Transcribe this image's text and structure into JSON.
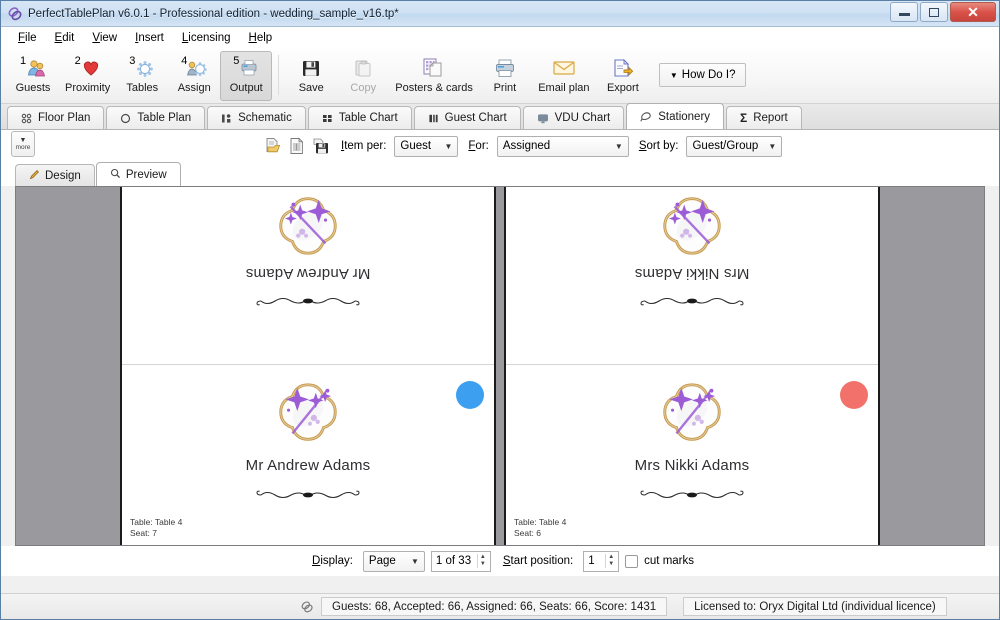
{
  "window": {
    "title": "PerfectTablePlan v6.0.1 - Professional edition - wedding_sample_v16.tp*",
    "app_icon": "app-logo-icon",
    "minimize_label": "Minimize",
    "maximize_label": "Maximize",
    "close_label": "Close"
  },
  "menu": {
    "items": [
      {
        "label": "File",
        "accel": "F"
      },
      {
        "label": "Edit",
        "accel": "E"
      },
      {
        "label": "View",
        "accel": "V"
      },
      {
        "label": "Insert",
        "accel": "I"
      },
      {
        "label": "Licensing",
        "accel": "L"
      },
      {
        "label": "Help",
        "accel": "H"
      }
    ]
  },
  "toolbar": {
    "buttons": [
      {
        "num": "1",
        "label": "Guests",
        "icon": "guests-icon",
        "state": "normal"
      },
      {
        "num": "2",
        "label": "Proximity",
        "icon": "heart-icon",
        "state": "normal"
      },
      {
        "num": "3",
        "label": "Tables",
        "icon": "table-icon",
        "state": "normal"
      },
      {
        "num": "4",
        "label": "Assign",
        "icon": "assign-icon",
        "state": "normal"
      },
      {
        "num": "5",
        "label": "Output",
        "icon": "output-icon",
        "state": "active"
      }
    ],
    "buttons2": [
      {
        "label": "Save",
        "icon": "floppy-icon",
        "state": "normal"
      },
      {
        "label": "Copy",
        "icon": "clipboard-icon",
        "state": "disabled"
      },
      {
        "label": "Posters & cards",
        "icon": "posters-icon",
        "state": "normal"
      },
      {
        "label": "Print",
        "icon": "printer-icon",
        "state": "normal"
      },
      {
        "label": "Email plan",
        "icon": "envelope-icon",
        "state": "normal"
      },
      {
        "label": "Export",
        "icon": "export-icon",
        "state": "normal"
      }
    ],
    "how_do_i": "How Do I?"
  },
  "tabs": {
    "items": [
      {
        "label": "Floor Plan",
        "icon": "floorplan-icon",
        "selected": false
      },
      {
        "label": "Table Plan",
        "icon": "circle-table-icon",
        "selected": false
      },
      {
        "label": "Schematic",
        "icon": "schematic-icon",
        "selected": false
      },
      {
        "label": "Table Chart",
        "icon": "table-chart-icon",
        "selected": false
      },
      {
        "label": "Guest Chart",
        "icon": "guest-chart-icon",
        "selected": false
      },
      {
        "label": "VDU Chart",
        "icon": "vdu-icon",
        "selected": false
      },
      {
        "label": "Stationery",
        "icon": "stationery-icon",
        "selected": true
      },
      {
        "label": "Report",
        "icon": "sigma-icon",
        "selected": false
      }
    ]
  },
  "subbar": {
    "more_label": "more",
    "more_caret": "▼",
    "icons": [
      {
        "name": "open-template-icon",
        "title": "Open template"
      },
      {
        "name": "new-template-icon",
        "title": "New template"
      },
      {
        "name": "save-template-icon",
        "title": "Save template"
      }
    ],
    "item_per_label": "Item per:",
    "item_per_accel": "I",
    "item_per_value": "Guest",
    "for_label": "For:",
    "for_accel": "F",
    "for_value": "Assigned",
    "sort_by_label": "Sort by:",
    "sort_by_accel": "S",
    "sort_by_value": "Guest/Group"
  },
  "inner_tabs": {
    "items": [
      {
        "label": "Design",
        "icon": "pencil-icon",
        "selected": false
      },
      {
        "label": "Preview",
        "icon": "magnifier-icon",
        "selected": true
      }
    ]
  },
  "preview": {
    "cards": [
      {
        "name": "Mr Andrew Adams",
        "table_line": "Table: Table 4",
        "seat_line": "Seat: 7",
        "dot_color": "#3d9ff0",
        "dot_class": "blue"
      },
      {
        "name": "Mrs Nikki Adams",
        "table_line": "Table: Table 4",
        "seat_line": "Seat: 6",
        "dot_color": "#f2726b",
        "dot_class": "red"
      }
    ]
  },
  "pagebar": {
    "display_label": "Display:",
    "display_accel": "D",
    "display_value": "Page",
    "page_value": "1 of 33",
    "start_position_label": "Start position:",
    "start_position_accel": "S",
    "start_position_value": "1",
    "cut_marks_label": "cut marks",
    "cut_marks_accel": "c",
    "cut_marks_checked": false
  },
  "statusbar": {
    "stats": "Guests: 68, Accepted: 66, Assigned: 66, Seats: 66, Score: 1431",
    "licence": "Licensed to: Oryx Digital Ltd (individual licence)",
    "icon": "status-logo-icon"
  },
  "colors": {
    "titlebar_accent": "#cfe1f3",
    "close_button": "#d9534a",
    "canvas_background": "#9a9a9e",
    "card_white": "#ffffff",
    "motif_purple": "#9b5cd6",
    "motif_gold": "#c79a4e"
  }
}
